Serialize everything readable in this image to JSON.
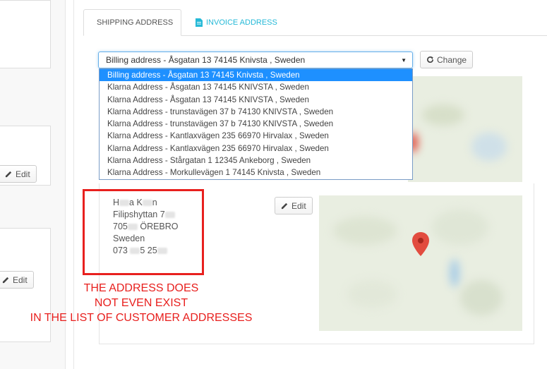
{
  "left_column": {
    "edit_label_1": "Edit",
    "edit_label_2": "Edit"
  },
  "tabs": [
    {
      "label": "SHIPPING ADDRESS",
      "icon": "truck-icon",
      "active": true
    },
    {
      "label": "INVOICE ADDRESS",
      "icon": "file-icon",
      "active": false
    }
  ],
  "address_select": {
    "selected": "Billing address - Åsgatan 13 74145 Knivsta , Sweden",
    "options": [
      "Billing address - Åsgatan 13 74145 Knivsta , Sweden",
      "Klarna Address - Åsgatan 13 74145 KNIVSTA , Sweden",
      "Klarna Address - Åsgatan 13 74145 KNIVSTA , Sweden",
      "Klarna Address - trunstavägen 37 b 74130 KNIVSTA , Sweden",
      "Klarna Address - trunstavägen 37 b 74130 KNIVSTA , Sweden",
      "Klarna Address - Kantlaxvägen 235 66970 Hirvalax , Sweden",
      "Klarna Address - Kantlaxvägen 235 66970 Hirvalax , Sweden",
      "Klarna Address - Stårgatan 1 12345 Ankeborg , Sweden",
      "Klarna Address - Morkullevägen 1 74145 Knivsta , Sweden"
    ]
  },
  "change_button": {
    "label": "Change",
    "icon": "refresh-icon"
  },
  "address_card": {
    "name_a": "H",
    "name_b": "a K",
    "name_c": "n",
    "street": "Filipshyttan 7",
    "postal_code": "705",
    "city": "ÖREBRO",
    "country": "Sweden",
    "phone_a": "073",
    "phone_b": "5 25"
  },
  "edit_button": {
    "label": "Edit",
    "icon": "pencil-icon"
  },
  "annotation": {
    "line1": "THE ADDRESS DOES",
    "line2": "NOT EVEN EXIST",
    "line3": "IN THE LIST OF CUSTOMER ADDRESSES"
  },
  "colors": {
    "accent": "#25b9d7",
    "annotation_red": "#e8201e",
    "selected_option_bg": "#1e90ff"
  }
}
